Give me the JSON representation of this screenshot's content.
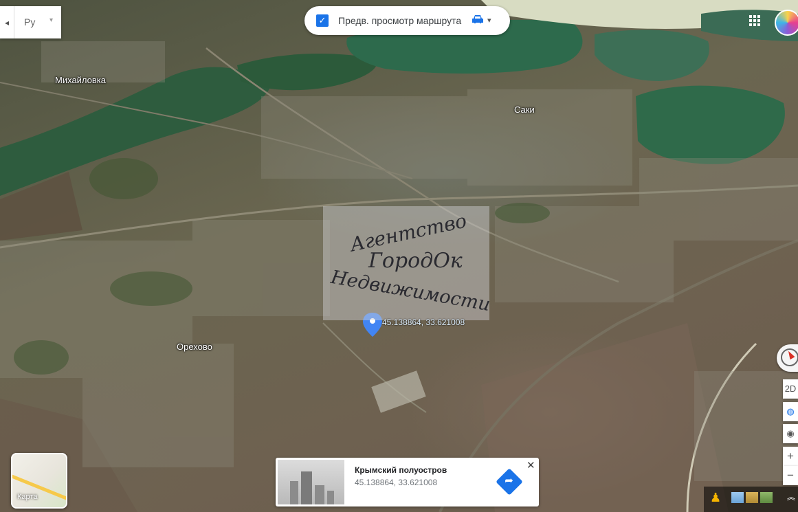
{
  "map": {
    "places": [
      {
        "key": "mikhailovka",
        "name": "Михайловка"
      },
      {
        "key": "saki",
        "name": "Саки"
      },
      {
        "key": "orekhovo",
        "name": "Орехово"
      }
    ],
    "marker_label": "45.138864, 33.621008",
    "watermark": {
      "line1": "Агентство",
      "line2": "ГородОк",
      "line3": "Недвижимости"
    }
  },
  "top_left": {
    "language_value": "Ру",
    "collapse_arrow": "◂",
    "dropdown_arrow": "▾"
  },
  "route_preview": {
    "checked": true,
    "check_glyph": "✓",
    "label": "Предв. просмотр маршрута",
    "car_icon": "car-icon",
    "dropdown_glyph": "▾"
  },
  "minimap": {
    "label": "Карта"
  },
  "place_card": {
    "title": "Крымский полуостров",
    "coordinates": "45.138864, 33.621008",
    "close_glyph": "✕",
    "directions_glyph": "➦"
  },
  "right_controls": {
    "view_mode": "2D",
    "globe_glyph": "◍",
    "locate_glyph": "◉",
    "zoom_in": "+",
    "zoom_out": "−",
    "expand_glyph": "︽",
    "pegman_glyph": "♟"
  },
  "colors": {
    "accent": "#1a73e8",
    "water": "#2f5a3e",
    "marker": "#4285f4"
  }
}
